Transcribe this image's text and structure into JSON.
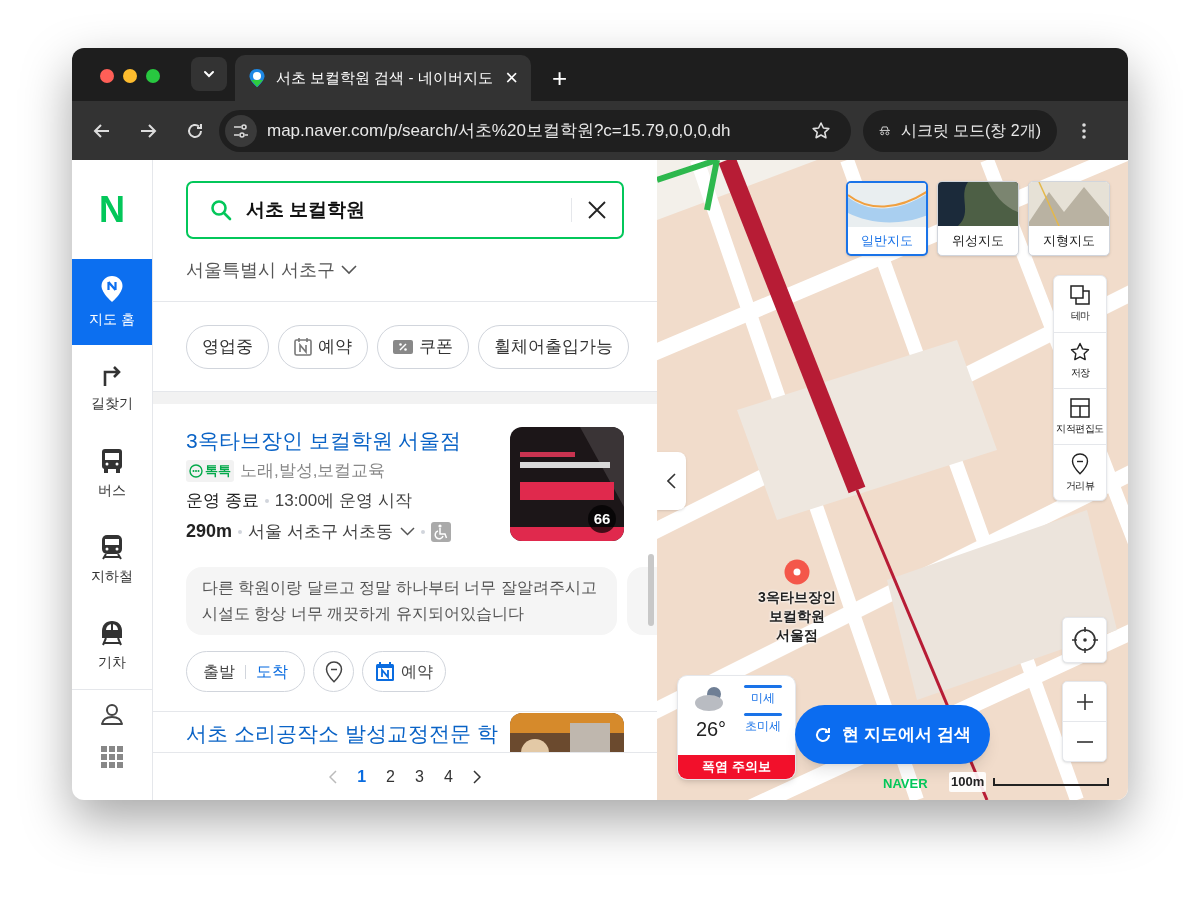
{
  "browser": {
    "tab": {
      "title": "서초 보컬학원 검색 - 네이버지도",
      "close": "×"
    },
    "new_tab": "+",
    "url": "map.naver.com/p/search/서초%20보컬학원?c=15.79,0,0,0,dh",
    "incognito": "시크릿 모드(창 2개)"
  },
  "nav": {
    "logo": "N",
    "items": [
      {
        "label": "지도 홈",
        "kind": "home",
        "selected": true
      },
      {
        "label": "길찾기",
        "kind": "directions",
        "selected": false
      },
      {
        "label": "버스",
        "kind": "bus",
        "selected": false
      },
      {
        "label": "지하철",
        "kind": "subway",
        "selected": false
      },
      {
        "label": "기차",
        "kind": "train",
        "selected": false
      }
    ]
  },
  "search": {
    "value": "서초 보컬학원"
  },
  "region": "서울특별시 서초구",
  "filters": [
    {
      "label": "영업중",
      "kind": "plain"
    },
    {
      "label": "예약",
      "kind": "booking"
    },
    {
      "label": "쿠폰",
      "kind": "coupon"
    },
    {
      "label": "휠체어출입가능",
      "kind": "plain"
    }
  ],
  "results": [
    {
      "title": "3옥타브장인 보컬학원 서울점",
      "talk_tag": "톡톡",
      "category": "노래,발성,보컬교육",
      "status": "운영 종료",
      "hours": "13:00에 운영 시작",
      "distance": "290m",
      "address": "서울 서초구 서초동",
      "wheelchair": true,
      "photo_count": "66",
      "review": "다른 학원이랑 달르고 정말 하나부터 너무 잘알려주시고 시설도 항상 너무 깨끗하게 유지되어있습니다",
      "actions": {
        "start": "출발",
        "arrive": "도착",
        "booking": "예약"
      }
    },
    {
      "title": "서초 소리공작소 발성교정전문 학"
    }
  ],
  "pagination": {
    "pages": [
      {
        "label": "1",
        "selected": true
      },
      {
        "label": "2",
        "selected": false
      },
      {
        "label": "3",
        "selected": false
      },
      {
        "label": "4",
        "selected": false
      }
    ]
  },
  "map": {
    "types": [
      {
        "label": "일반지도",
        "kind": "normal",
        "selected": true
      },
      {
        "label": "위성지도",
        "kind": "satellite",
        "selected": false
      },
      {
        "label": "지형지도",
        "kind": "terrain",
        "selected": false
      }
    ],
    "tools": [
      {
        "label": "테마",
        "kind": "theme"
      },
      {
        "label": "저장",
        "kind": "save"
      },
      {
        "label": "지적편집도",
        "kind": "cadastral"
      },
      {
        "label": "거리뷰",
        "kind": "street"
      }
    ],
    "marker_label": "3옥타브장인 보컬학원 서울점",
    "weather": {
      "temperature": "26°",
      "fine_dust": "미세",
      "ultrafine_dust": "초미세",
      "alert": "폭염 주의보"
    },
    "research_button": "현 지도에서 검색",
    "logo": "NAVER",
    "scale": "100m"
  }
}
